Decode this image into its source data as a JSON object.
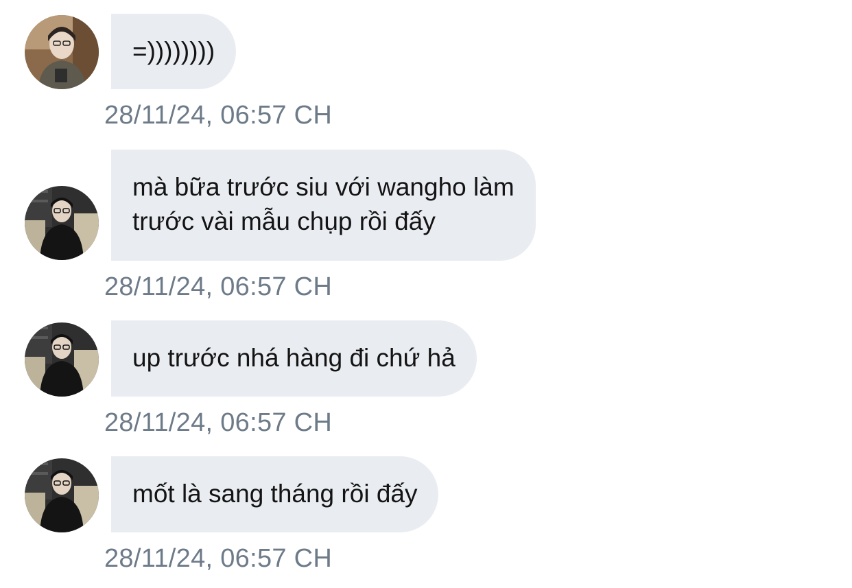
{
  "messages": [
    {
      "sender": "girl-avatar",
      "text": "=))))))))",
      "timestamp": "28/11/24, 06:57 CH"
    },
    {
      "sender": "boy-avatar",
      "text": "mà bữa trước siu với wangho làm\ntrước vài mẫu chụp rồi đấy",
      "timestamp": "28/11/24, 06:57 CH"
    },
    {
      "sender": "boy-avatar",
      "text": "up trước nhá hàng đi chứ hả",
      "timestamp": "28/11/24, 06:57 CH"
    },
    {
      "sender": "boy-avatar",
      "text": "mốt là sang tháng rồi đấy",
      "timestamp": "28/11/24, 06:57 CH"
    }
  ],
  "colors": {
    "bubble_bg": "#e9ecf1",
    "timestamp": "#6d7a88",
    "text": "#141414"
  }
}
